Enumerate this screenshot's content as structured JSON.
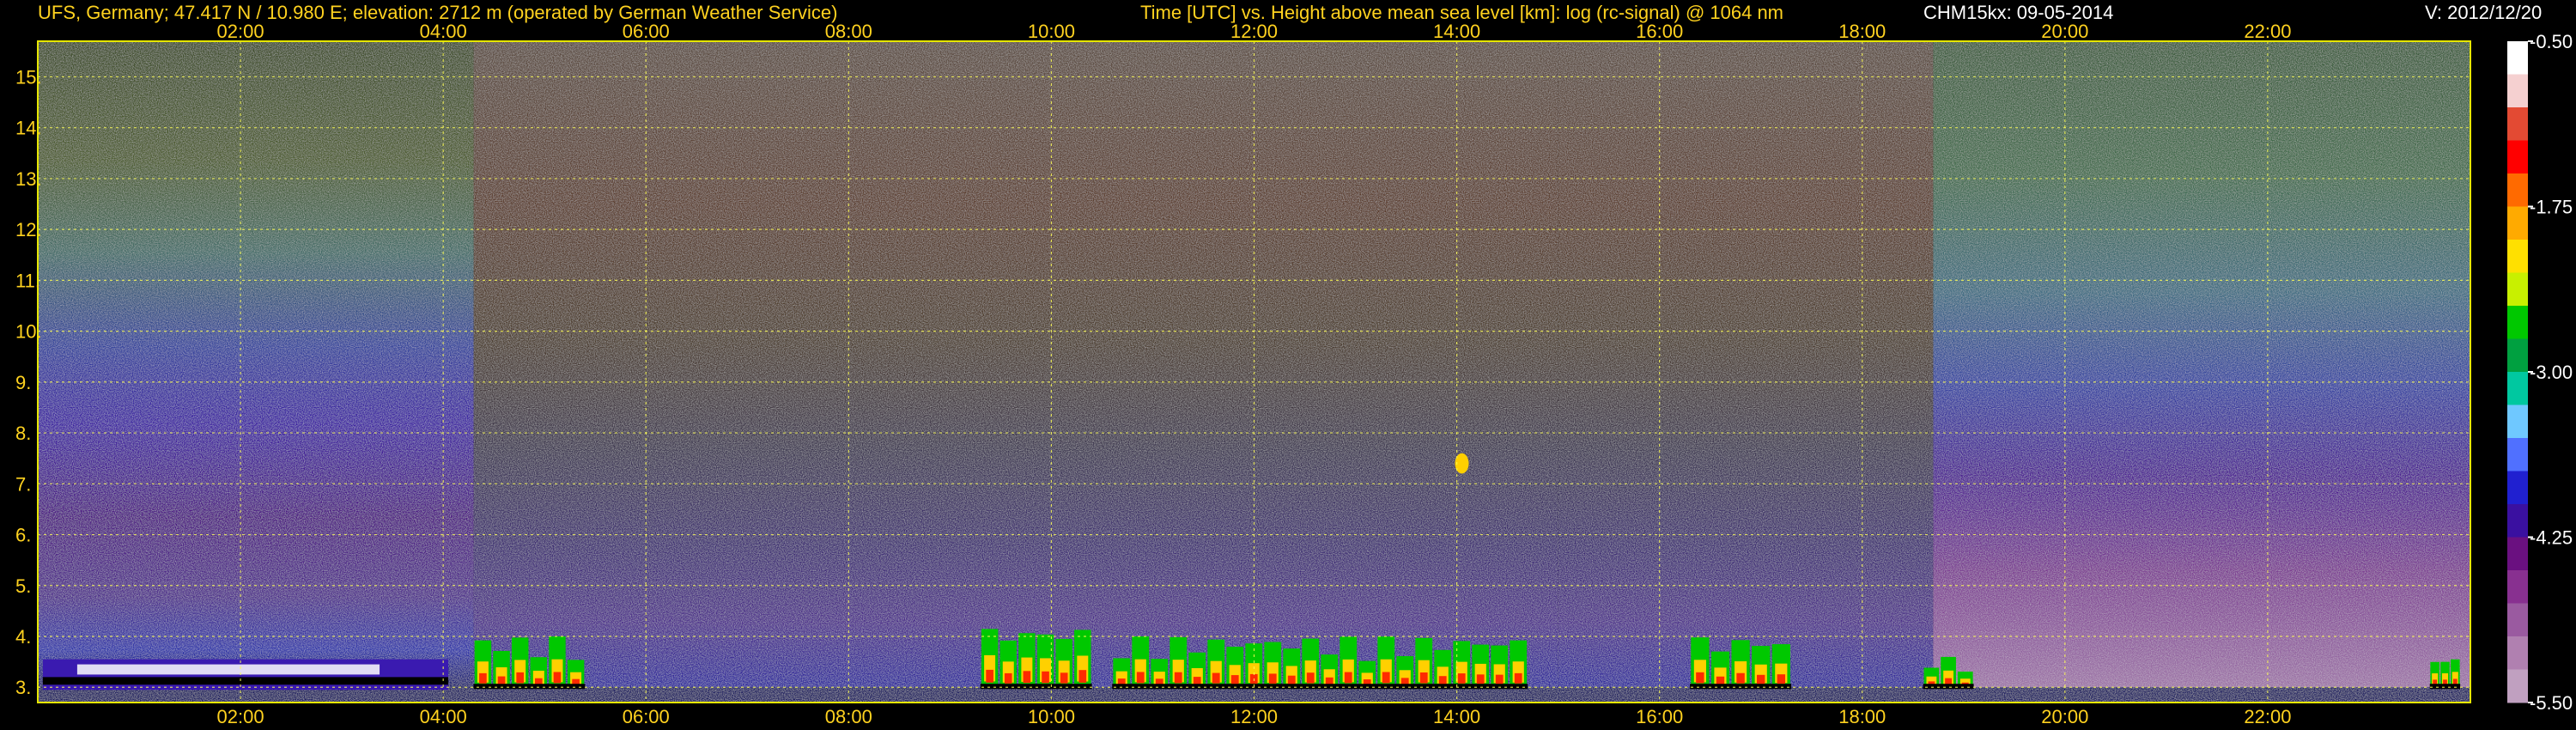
{
  "header": {
    "site": "UFS, Germany; 47.417 N / 10.980 E; elevation: 2712 m  (operated by German Weather Service)",
    "title": "Time [UTC] vs. Height above mean sea level [km]: log (rc-signal) @ 1064 nm",
    "instrument_date": "CHM15kx: 09-05-2014",
    "version": "V: 2012/12/20"
  },
  "colors": {
    "header_text": "#ffd21f",
    "header_text_white": "#ffffff",
    "axis_text": "#ffd21f",
    "grid": "#ffff55",
    "frame": "#e6e600",
    "background": "#000000"
  },
  "chart_data": {
    "type": "heatmap",
    "title": "Time [UTC] vs. Height above mean sea level [km]: log (rc-signal) @ 1064 nm",
    "xlabel": "Time [UTC]",
    "ylabel": "Height above mean sea level [km]",
    "x_ticks": [
      "02:00",
      "04:00",
      "06:00",
      "08:00",
      "10:00",
      "12:00",
      "14:00",
      "16:00",
      "18:00",
      "20:00",
      "22:00"
    ],
    "x_tick_hours": [
      2,
      4,
      6,
      8,
      10,
      12,
      14,
      16,
      18,
      20,
      22
    ],
    "xlim_hours": [
      0,
      24
    ],
    "y_ticks": [
      "3.",
      "4.",
      "5.",
      "6.",
      "7.",
      "8.",
      "9.",
      "10.",
      "11.",
      "12.",
      "13.",
      "14.",
      "15."
    ],
    "y_tick_values": [
      3,
      4,
      5,
      6,
      7,
      8,
      9,
      10,
      11,
      12,
      13,
      14,
      15
    ],
    "ylim_km": [
      2.7,
      15.7
    ],
    "grid": true,
    "colorbar": {
      "label": "log (rc-signal)",
      "ticks": [
        "-0.50",
        "-1.75",
        "-3.00",
        "-4.25",
        "-5.50"
      ],
      "tick_values": [
        -0.5,
        -1.75,
        -3.0,
        -4.25,
        -5.5
      ],
      "range": [
        -5.5,
        -0.5
      ],
      "colors_top_to_bottom": [
        "#ffffff",
        "#f5d0d0",
        "#e34a33",
        "#ff0000",
        "#ff6a00",
        "#ffaa00",
        "#ffe000",
        "#c8f000",
        "#00c800",
        "#00a040",
        "#00c8a0",
        "#6fc8ff",
        "#5070ff",
        "#2020d0",
        "#3a10a0",
        "#6a1080",
        "#883090",
        "#9a5aa0",
        "#b080b0",
        "#c0a0c0"
      ]
    },
    "signal_regions": [
      {
        "start_h": 0.05,
        "end_h": 4.05,
        "base_km": 2.95,
        "top_km": 3.55,
        "kind": "layer",
        "note": "aerosol layer with white boundary"
      },
      {
        "start_h": 4.3,
        "end_h": 5.4,
        "base_km": 3.0,
        "top_km": 4.0,
        "kind": "convective"
      },
      {
        "start_h": 9.3,
        "end_h": 10.4,
        "base_km": 3.0,
        "top_km": 4.2,
        "kind": "convective"
      },
      {
        "start_h": 10.6,
        "end_h": 14.7,
        "base_km": 3.0,
        "top_km": 4.0,
        "kind": "convective"
      },
      {
        "start_h": 14.0,
        "end_h": 14.1,
        "base_km": 7.2,
        "top_km": 7.6,
        "kind": "cloud"
      },
      {
        "start_h": 16.3,
        "end_h": 17.3,
        "base_km": 3.0,
        "top_km": 4.0,
        "kind": "convective"
      },
      {
        "start_h": 18.6,
        "end_h": 19.1,
        "base_km": 3.0,
        "top_km": 3.6,
        "kind": "convective"
      },
      {
        "start_h": 23.6,
        "end_h": 23.9,
        "base_km": 3.0,
        "top_km": 3.6,
        "kind": "convective"
      }
    ]
  }
}
